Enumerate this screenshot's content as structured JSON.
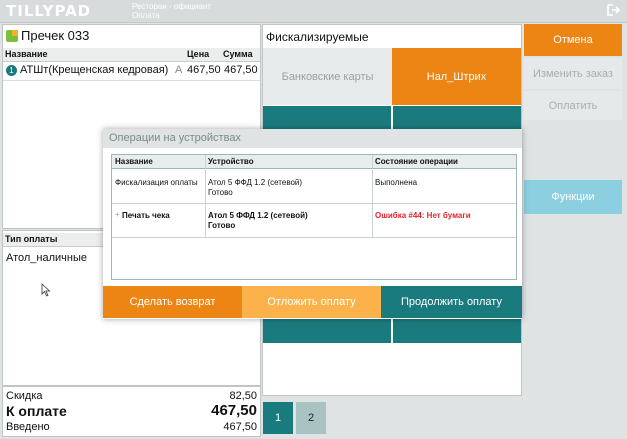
{
  "topbar": {
    "logo": "TILLYPAD",
    "title1": "Ресторан - официант",
    "title2": "Оплата"
  },
  "order": {
    "title": "Пречек 033",
    "columns": {
      "name": "Название",
      "price": "Цена",
      "sum": "Сумма"
    },
    "items": [
      {
        "qty": "1",
        "name": "АТШт(Крещенская кедровая)",
        "flag": "А",
        "price": "467,50",
        "sum": "467,50"
      }
    ]
  },
  "payment": {
    "header": "Тип оплаты",
    "method": "Атол_наличные"
  },
  "totals": {
    "discount_label": "Скидка",
    "discount": "82,50",
    "due_label": "К оплате",
    "due": "467,50",
    "entered_label": "Введено",
    "entered": "467,50"
  },
  "fiscal": {
    "title": "Фискализируемые",
    "bank_cards": "Банковские карты",
    "cash_tile": "Нал_Штрих"
  },
  "right": {
    "cancel": "Отмена",
    "change_order": "Изменить заказ",
    "pay": "Оплатить",
    "functions": "Функции"
  },
  "modal": {
    "title": "Операции на устройствах",
    "columns": {
      "name": "Название",
      "device": "Устройство",
      "status": "Состояние операции"
    },
    "rows": [
      {
        "name": "Фискализация оплаты",
        "device": "Атол 5 ФФД 1.2 (сетевой)",
        "device_state": "Готово",
        "status": "Выполнена"
      },
      {
        "name": "Печать чека",
        "device": "Атол 5 ФФД 1.2 (сетевой)",
        "device_state": "Готово",
        "status": "Ошибка #44: Нет бумаги"
      }
    ],
    "buttons": {
      "refund": "Сделать возврат",
      "defer": "Отложить оплату",
      "continue": "Продолжить оплату"
    }
  },
  "pages": [
    "1",
    "2"
  ],
  "colors": {
    "orange": "#ec8513",
    "teal": "#1a7b7e",
    "light_orange": "#fbb24b",
    "light_blue": "#8ccfe0",
    "error": "#e0262b"
  }
}
